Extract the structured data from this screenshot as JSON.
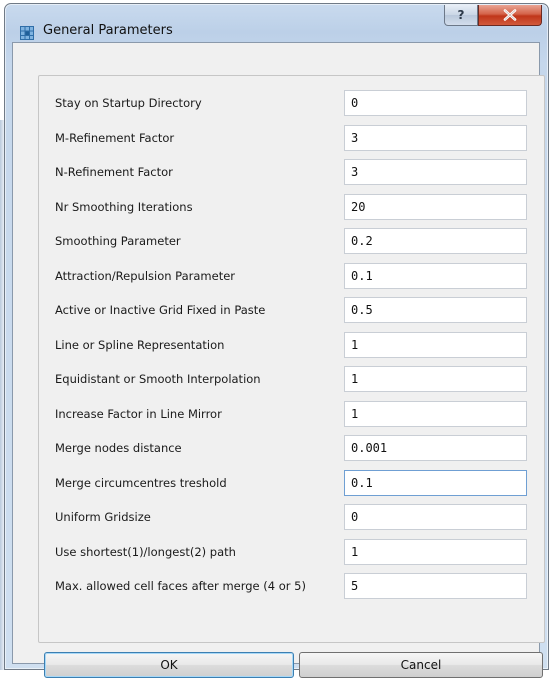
{
  "window": {
    "title": "General Parameters",
    "help_glyph": "?",
    "colors": {
      "frame": "#c5d7ec",
      "close_button": "#c7452a",
      "client_bg": "#f0f0f0",
      "focus_border": "#6f9fd3"
    }
  },
  "parameters": [
    {
      "label": "Stay on Startup Directory",
      "value": "0"
    },
    {
      "label": "M-Refinement Factor",
      "value": "3"
    },
    {
      "label": "N-Refinement Factor",
      "value": "3"
    },
    {
      "label": "Nr Smoothing Iterations",
      "value": "20"
    },
    {
      "label": "Smoothing Parameter",
      "value": "0.2"
    },
    {
      "label": "Attraction/Repulsion Parameter",
      "value": "0.1"
    },
    {
      "label": "Active or Inactive Grid Fixed in Paste",
      "value": "0.5"
    },
    {
      "label": "Line or Spline Representation",
      "value": "1"
    },
    {
      "label": "Equidistant or Smooth Interpolation",
      "value": "1"
    },
    {
      "label": "Increase Factor in Line Mirror",
      "value": "1"
    },
    {
      "label": "Merge nodes distance",
      "value": "0.001"
    },
    {
      "label": "Merge circumcentres treshold",
      "value": "0.1"
    },
    {
      "label": "Uniform Gridsize",
      "value": "0"
    },
    {
      "label": "Use shortest(1)/longest(2) path",
      "value": "1"
    },
    {
      "label": "Max. allowed cell faces after merge (4 or 5)",
      "value": "5"
    }
  ],
  "focused_field": "Merge circumcentres treshold",
  "buttons": {
    "ok": "OK",
    "cancel": "Cancel"
  },
  "icons": {
    "app": "grid-app-icon",
    "help": "help-icon",
    "close": "close-icon"
  }
}
